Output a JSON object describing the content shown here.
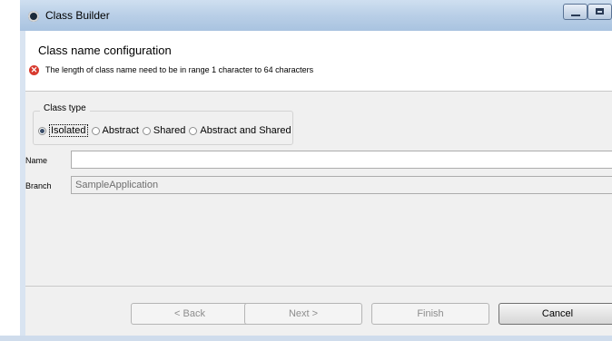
{
  "window": {
    "title": "Class Builder"
  },
  "header": {
    "title": "Class name configuration",
    "error_message": "The length of class name need to be  in range 1 character to 64 characters",
    "error_icon": "error-icon"
  },
  "class_type": {
    "legend": "Class type",
    "options": [
      {
        "label": "Isolated",
        "checked": true
      },
      {
        "label": "Abstract",
        "checked": false
      },
      {
        "label": "Shared",
        "checked": false
      },
      {
        "label": "Abstract and Shared",
        "checked": false
      }
    ]
  },
  "fields": {
    "name_label": "Name",
    "name_value": "",
    "branch_label": "Branch",
    "branch_value": "SampleApplication"
  },
  "buttons": {
    "back": "< Back",
    "next": "Next >",
    "finish": "Finish",
    "cancel": "Cancel"
  },
  "colors": {
    "title_bar": "#b9cfe7",
    "error": "#d83a2e"
  }
}
